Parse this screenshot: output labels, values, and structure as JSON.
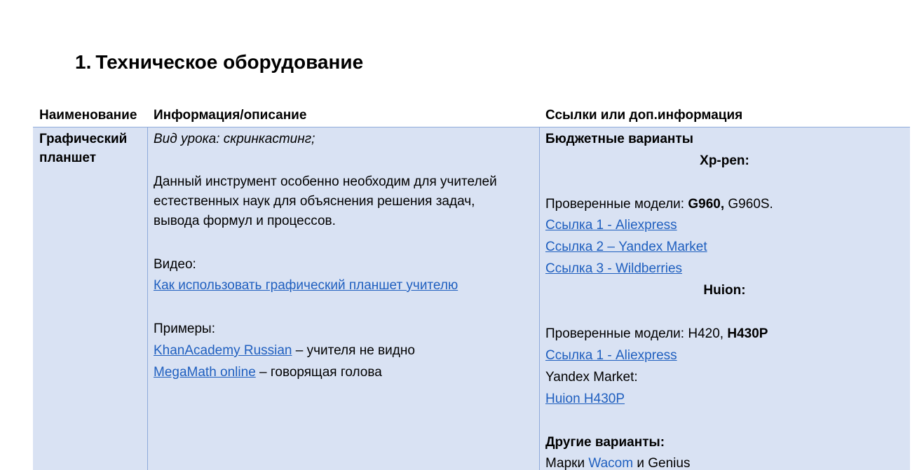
{
  "heading": {
    "number": "1.",
    "text": "Техническое оборудование"
  },
  "table": {
    "headers": [
      "Наименование",
      "Информация/описание",
      "Ссылки или доп.информация"
    ],
    "row": {
      "name_line1": "Графический",
      "name_line2": "планшет",
      "info": {
        "lesson_type": "Вид урока: скринкастинг;",
        "desc_line1": "Данный инструмент особенно необходим для учителей",
        "desc_line2": "естественных наук для объяснения решения задач,",
        "desc_line3": "вывода формул и процессов.",
        "video_label": "Видео:",
        "video_link": "Как использовать графический планшет учителю",
        "examples_label": "Примеры:",
        "example1_link": "KhanAcademy Russian",
        "example1_note": " – учителя не видно",
        "example2_link": "MegaMath online",
        "example2_note": " – говорящая голова"
      },
      "links": {
        "budget_title": "Бюджетные варианты",
        "brand1": "Xp-pen:",
        "brand1_models_prefix": "Проверенные модели: ",
        "brand1_model_bold": "G960,",
        "brand1_model_rest": " G960S.",
        "brand1_link1": "Ссылка 1 - Aliexpress",
        "brand1_link2": "Ссылка 2 – Yandex Market",
        "brand1_link3": "Ссылка 3 - Wildberries",
        "brand2": "Huion:",
        "brand2_models_prefix": "Проверенные модели: H420, ",
        "brand2_model_bold": "H430P",
        "brand2_link1": "Ссылка 1 - Aliexpress",
        "yandex_label": "Yandex Market:",
        "brand2_link2": "Huion H430P",
        "other_title": "Другие варианты:",
        "other_prefix": "Марки ",
        "other_wacom": "Wacom",
        "other_suffix": " и Genius"
      }
    }
  },
  "colors": {
    "row_background": "#d9e2f3",
    "border": "#8eaadb",
    "link": "#1f5fbf"
  }
}
